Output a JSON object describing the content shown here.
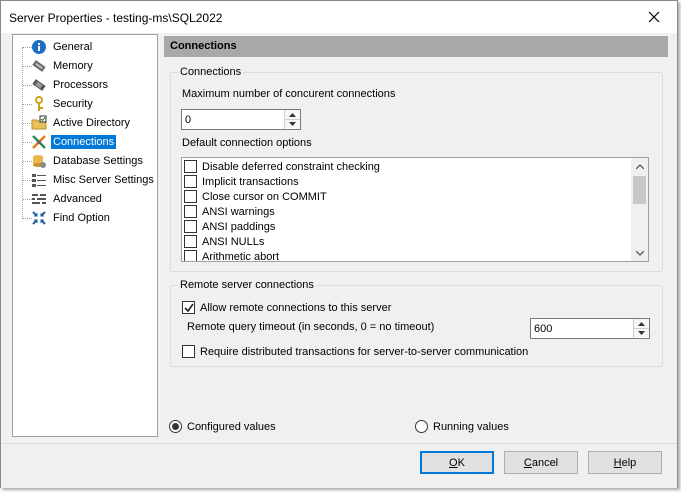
{
  "window": {
    "title": "Server Properties - testing-ms\\SQL2022"
  },
  "tree": {
    "items": [
      {
        "label": "General",
        "icon": "info-icon",
        "selected": false
      },
      {
        "label": "Memory",
        "icon": "memory-icon",
        "selected": false
      },
      {
        "label": "Processors",
        "icon": "processor-icon",
        "selected": false
      },
      {
        "label": "Security",
        "icon": "key-icon",
        "selected": false
      },
      {
        "label": "Active Directory",
        "icon": "active-directory-icon",
        "selected": false
      },
      {
        "label": "Connections",
        "icon": "connections-icon",
        "selected": true
      },
      {
        "label": "Database Settings",
        "icon": "database-settings-icon",
        "selected": false
      },
      {
        "label": "Misc Server Settings",
        "icon": "misc-settings-icon",
        "selected": false
      },
      {
        "label": "Advanced",
        "icon": "advanced-icon",
        "selected": false
      },
      {
        "label": "Find Option",
        "icon": "find-option-icon",
        "selected": false
      }
    ]
  },
  "panel": {
    "header": "Connections",
    "connections": {
      "title": "Connections",
      "max_label": "Maximum number of concurent connections",
      "max_value": "0",
      "default_options_label": "Default connection options",
      "options": [
        {
          "label": "Disable deferred constraint checking",
          "checked": false
        },
        {
          "label": "Implicit transactions",
          "checked": false
        },
        {
          "label": "Close cursor on COMMIT",
          "checked": false
        },
        {
          "label": "ANSI warnings",
          "checked": false
        },
        {
          "label": "ANSI paddings",
          "checked": false
        },
        {
          "label": "ANSI NULLs",
          "checked": false
        },
        {
          "label": "Arithmetic abort",
          "checked": false
        }
      ]
    },
    "remote": {
      "title": "Remote server connections",
      "allow_label": "Allow remote connections to this server",
      "allow_checked": true,
      "timeout_label": "Remote query timeout (in seconds, 0 = no timeout)",
      "timeout_value": "600",
      "distributed_label": "Require distributed transactions for server-to-server communication",
      "distributed_checked": false
    },
    "values_mode": {
      "configured_label": "Configured values",
      "running_label": "Running values",
      "selected": "configured"
    }
  },
  "buttons": {
    "ok": {
      "prefix": "",
      "mnemonic": "O",
      "suffix": "K"
    },
    "cancel": {
      "prefix": "",
      "mnemonic": "C",
      "suffix": "ancel"
    },
    "help": {
      "prefix": "",
      "mnemonic": "H",
      "suffix": "elp"
    }
  }
}
